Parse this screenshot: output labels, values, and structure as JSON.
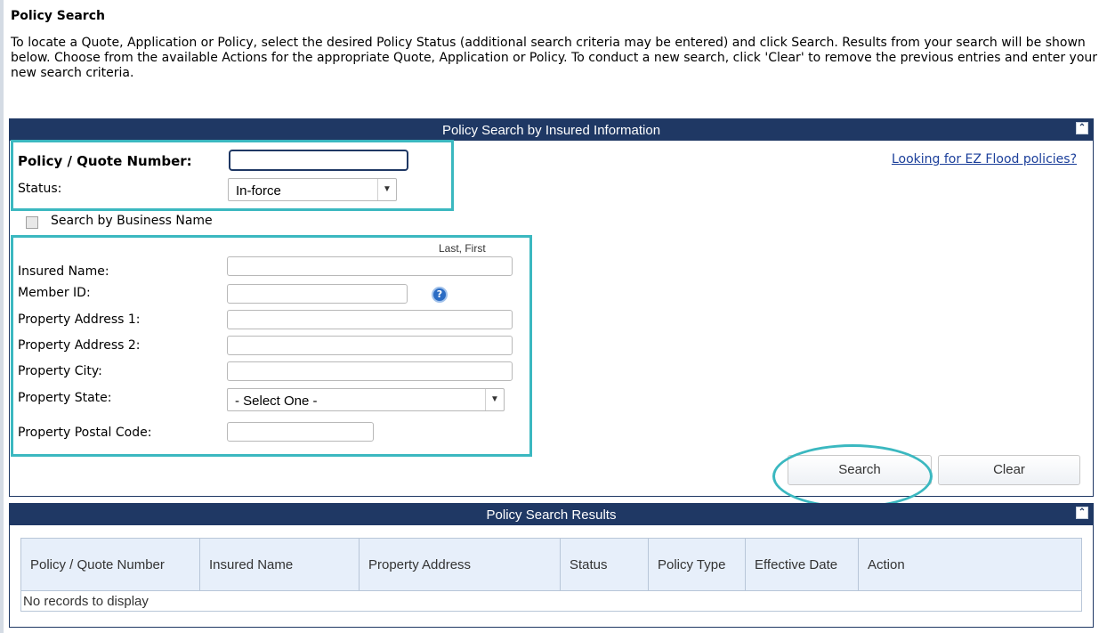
{
  "page": {
    "title": "Policy Search",
    "intro": "To locate a Quote, Application or Policy, select the desired Policy Status (additional search criteria may be entered) and click Search. Results from your search will be shown below. Choose from the available Actions for the appropriate Quote, Application or Policy. To conduct a new search, click 'Clear' to remove the previous entries and enter your new search criteria."
  },
  "search_panel": {
    "title": "Policy Search by Insured Information",
    "collapse_icon": "double-chevron-up-icon",
    "ez_link": "Looking for EZ Flood policies?",
    "policy_number_label": "Policy / Quote Number:",
    "policy_number_value": "",
    "status_label": "Status:",
    "status_value": "In-force",
    "business_checkbox_label": "Search by Business Name",
    "name_hint": "Last, First",
    "insured_name_label": "Insured Name:",
    "member_id_label": "Member ID:",
    "address1_label": "Property Address 1:",
    "address2_label": "Property Address 2:",
    "city_label": "Property City:",
    "state_label": "Property State:",
    "state_value": "- Select One -",
    "postal_label": "Property Postal Code:",
    "search_button": "Search",
    "clear_button": "Clear"
  },
  "results_panel": {
    "title": "Policy Search Results",
    "columns": [
      "Policy / Quote Number",
      "Insured Name",
      "Property Address",
      "Status",
      "Policy Type",
      "Effective Date",
      "Action"
    ],
    "empty_message": "No records to display"
  },
  "colors": {
    "header_bg": "#1f3864",
    "highlight": "#3bb8c0",
    "link": "#1a3e9a"
  }
}
